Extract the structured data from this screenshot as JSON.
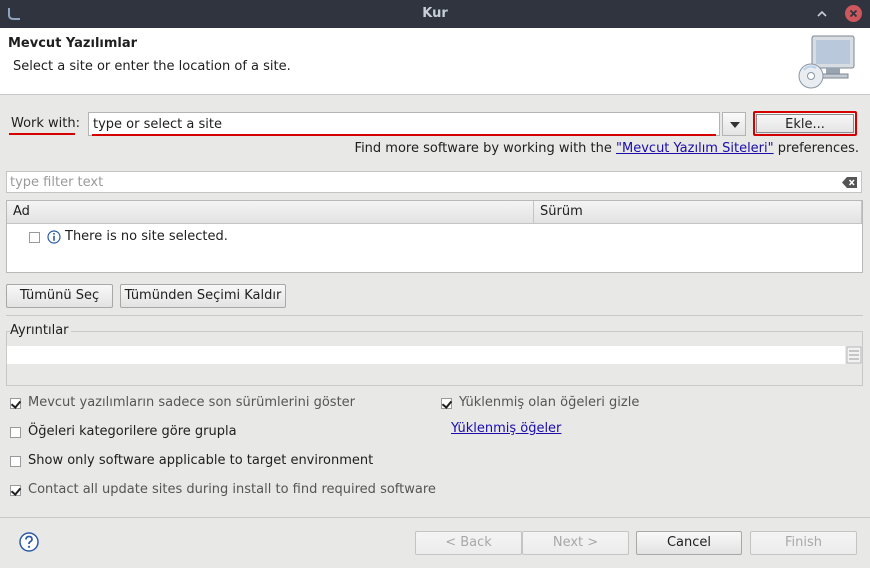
{
  "window": {
    "title": "Kur"
  },
  "header": {
    "title": "Mevcut Yazılımlar",
    "subtitle": "Select a site or enter the location of a site."
  },
  "work_with": {
    "label": "Work with:",
    "value": "type or select a site",
    "add_button": "Ekle..."
  },
  "find_more": {
    "prefix": "Find more software by working with the ",
    "link": "\"Mevcut Yazılım Siteleri\"",
    "suffix": " preferences."
  },
  "filter": {
    "placeholder": "type filter text"
  },
  "table": {
    "columns": [
      "Ad",
      "Sürüm"
    ],
    "message": "There is no site selected."
  },
  "buttons": {
    "select_all": "Tümünü Seç",
    "deselect_all": "Tümünden Seçimi Kaldır",
    "back": "< Back",
    "next": "Next >",
    "cancel": "Cancel",
    "finish": "Finish"
  },
  "details": {
    "label": "Ayrıntılar"
  },
  "options": {
    "latest_only": {
      "label": "Mevcut yazılımların sadece son sürümlerini göster",
      "checked": true
    },
    "group_by_category": {
      "label": "Öğeleri kategorilere göre grupla",
      "checked": false
    },
    "target_env": {
      "label": "Show only software applicable to target environment",
      "checked": false
    },
    "contact_sites": {
      "label": "Contact all update sites during install to find required software",
      "checked": true
    },
    "hide_installed": {
      "label": "Yüklenmiş olan öğeleri gizle",
      "checked": true
    },
    "installed_link": "Yüklenmiş öğeler"
  },
  "colors": {
    "highlight": "#d40000",
    "link": "#1a0dab",
    "titlebar": "#2f343f",
    "close": "#cc575d"
  }
}
